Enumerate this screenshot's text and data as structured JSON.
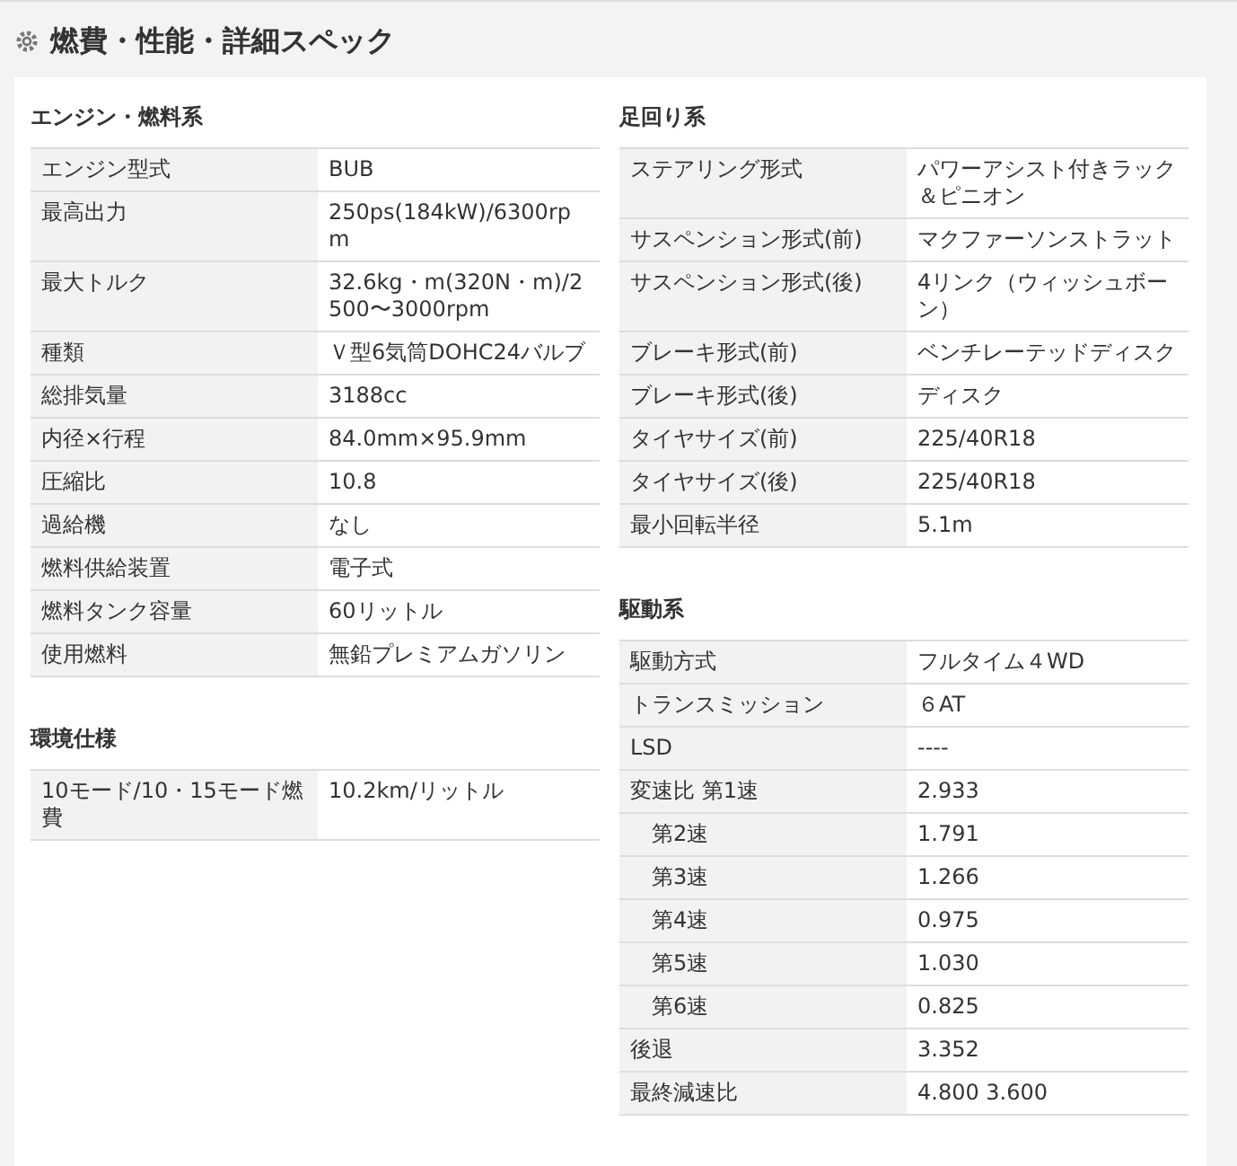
{
  "title": "燃費・性能・詳細スペック",
  "columns": [
    {
      "sections": [
        {
          "heading": "エンジン・燃料系",
          "rows": [
            {
              "label": "エンジン型式",
              "value": "BUB"
            },
            {
              "label": "最高出力",
              "value": "250ps(184kW)/6300rpm"
            },
            {
              "label": "最大トルク",
              "value": "32.6kg・m(320N・m)/2500〜3000rpm"
            },
            {
              "label": "種類",
              "value": "Ｖ型6気筒DOHC24バルブ"
            },
            {
              "label": "総排気量",
              "value": "3188cc"
            },
            {
              "label": "内径×行程",
              "value": "84.0mm×95.9mm"
            },
            {
              "label": "圧縮比",
              "value": "10.8"
            },
            {
              "label": "過給機",
              "value": "なし"
            },
            {
              "label": "燃料供給装置",
              "value": "電子式"
            },
            {
              "label": "燃料タンク容量",
              "value": "60リットル"
            },
            {
              "label": "使用燃料",
              "value": "無鉛プレミアムガソリン"
            }
          ]
        },
        {
          "heading": "環境仕様",
          "rows": [
            {
              "label": "10モード/10・15モード燃費",
              "value": "10.2km/リットル"
            }
          ]
        }
      ]
    },
    {
      "sections": [
        {
          "heading": "足回り系",
          "rows": [
            {
              "label": "ステアリング形式",
              "value": "パワーアシスト付きラック＆ピニオン"
            },
            {
              "label": "サスペンション形式(前)",
              "value": "マクファーソンストラット"
            },
            {
              "label": "サスペンション形式(後)",
              "value": "4リンク（ウィッシュボーン）"
            },
            {
              "label": "ブレーキ形式(前)",
              "value": "ベンチレーテッドディスク"
            },
            {
              "label": "ブレーキ形式(後)",
              "value": "ディスク"
            },
            {
              "label": "タイヤサイズ(前)",
              "value": "225/40R18"
            },
            {
              "label": "タイヤサイズ(後)",
              "value": "225/40R18"
            },
            {
              "label": "最小回転半径",
              "value": "5.1m"
            }
          ]
        },
        {
          "heading": "駆動系",
          "rows": [
            {
              "label": "駆動方式",
              "value": "フルタイム４WD"
            },
            {
              "label": "トランスミッション",
              "value": "６AT"
            },
            {
              "label": "LSD",
              "value": "----"
            },
            {
              "label": "変速比 第1速",
              "value": "2.933"
            },
            {
              "label": "第2速",
              "value": "1.791",
              "indented": true
            },
            {
              "label": "第3速",
              "value": "1.266",
              "indented": true
            },
            {
              "label": "第4速",
              "value": "0.975",
              "indented": true
            },
            {
              "label": "第5速",
              "value": "1.030",
              "indented": true
            },
            {
              "label": "第6速",
              "value": "0.825",
              "indented": true
            },
            {
              "label": "後退",
              "value": "3.352"
            },
            {
              "label": "最終減速比",
              "value": "4.800 3.600"
            }
          ]
        }
      ]
    }
  ]
}
